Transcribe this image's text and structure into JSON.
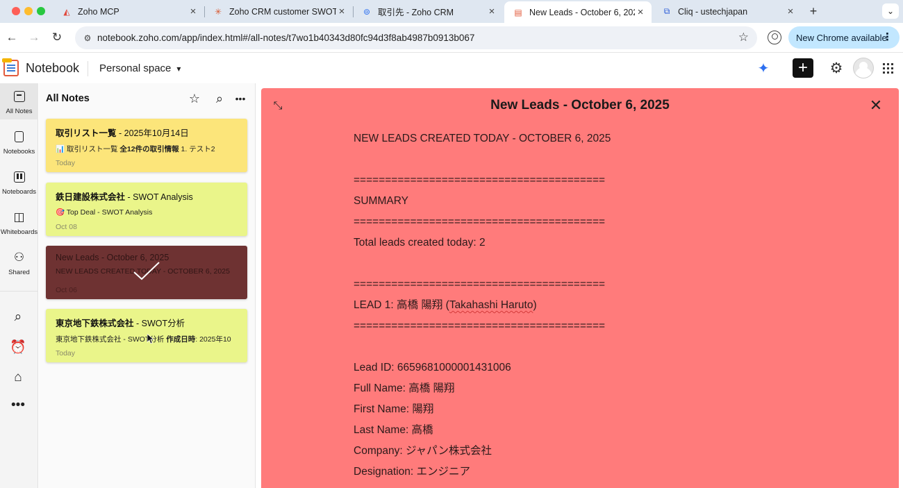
{
  "browser": {
    "tabs": [
      {
        "title": "Zoho MCP",
        "icon": "zoho-mcp-icon",
        "active": false
      },
      {
        "title": "Zoho CRM customer SWOT a",
        "icon": "spark-icon",
        "active": false
      },
      {
        "title": "取引先 - Zoho CRM",
        "icon": "crm-icon",
        "active": false
      },
      {
        "title": "New Leads - October 6, 2025",
        "icon": "notebook-icon",
        "active": true
      },
      {
        "title": "Cliq - ustechjapan",
        "icon": "cliq-icon",
        "active": false
      }
    ],
    "url": "notebook.zoho.com/app/index.html#/all-notes/t7wo1b40343d80fc94d3f8ab4987b0913b067",
    "update_label": "New Chrome available"
  },
  "app": {
    "name": "Notebook",
    "space": "Personal space"
  },
  "rail": {
    "items": [
      {
        "label": "All Notes",
        "icon": "all-notes-icon"
      },
      {
        "label": "Notebooks",
        "icon": "notebooks-icon"
      },
      {
        "label": "Noteboards",
        "icon": "noteboards-icon"
      },
      {
        "label": "Whiteboards",
        "icon": "whiteboards-icon"
      },
      {
        "label": "Shared",
        "icon": "shared-icon"
      }
    ]
  },
  "list": {
    "title": "All Notes",
    "notes": [
      {
        "title_bold": "取引リスト一覧",
        "title_rest": " - 2025年10月14日",
        "preview_pre": "📊 取引リスト一覧 ",
        "preview_bold": "全12件の取引情報",
        "preview_post": " 1. テスト2",
        "date": "Today",
        "color": "#fce57a"
      },
      {
        "title_bold": "鉄日建設株式会社",
        "title_rest": " - SWOT Analysis",
        "preview_pre": "🎯 Top Deal - SWOT Analysis",
        "preview_bold": "",
        "preview_post": "",
        "date": "Oct 08",
        "color": "#eaf58a"
      },
      {
        "title_bold": "",
        "title_rest": "New Leads - October 6, 2025",
        "preview_pre": "NEW LEADS CREATED TODAY - OCTOBER 6, 2025",
        "preview_bold": "",
        "preview_post": "",
        "date": "Oct 06",
        "color": "#6e3232"
      },
      {
        "title_bold": "東京地下鉄株式会社",
        "title_rest": " - SWOT分析",
        "preview_pre": "東京地下鉄株式会社 - SWOT分析 ",
        "preview_bold": "作成日時",
        "preview_post": ": 2025年10",
        "date": "Today",
        "color": "#eaf58a"
      }
    ]
  },
  "note": {
    "title": "New Leads - October 6, 2025",
    "background": "#ff7b7b",
    "lines": [
      "NEW LEADS CREATED TODAY - OCTOBER 6, 2025",
      "",
      "========================================",
      "SUMMARY",
      "========================================",
      "Total leads created today: 2",
      "",
      "========================================",
      "LEAD 1: 高橋 陽翔 (",
      "========================================",
      "",
      "Lead ID: 6659681000001431006",
      "Full Name: 高橋 陽翔",
      "First Name: 陽翔",
      "Last Name: 高橋",
      "Company: ジャパン株式会社",
      "Designation: エンジニア"
    ],
    "lead_name_romaji": "Takahashi Haruto",
    "lead_name_close": ")"
  }
}
